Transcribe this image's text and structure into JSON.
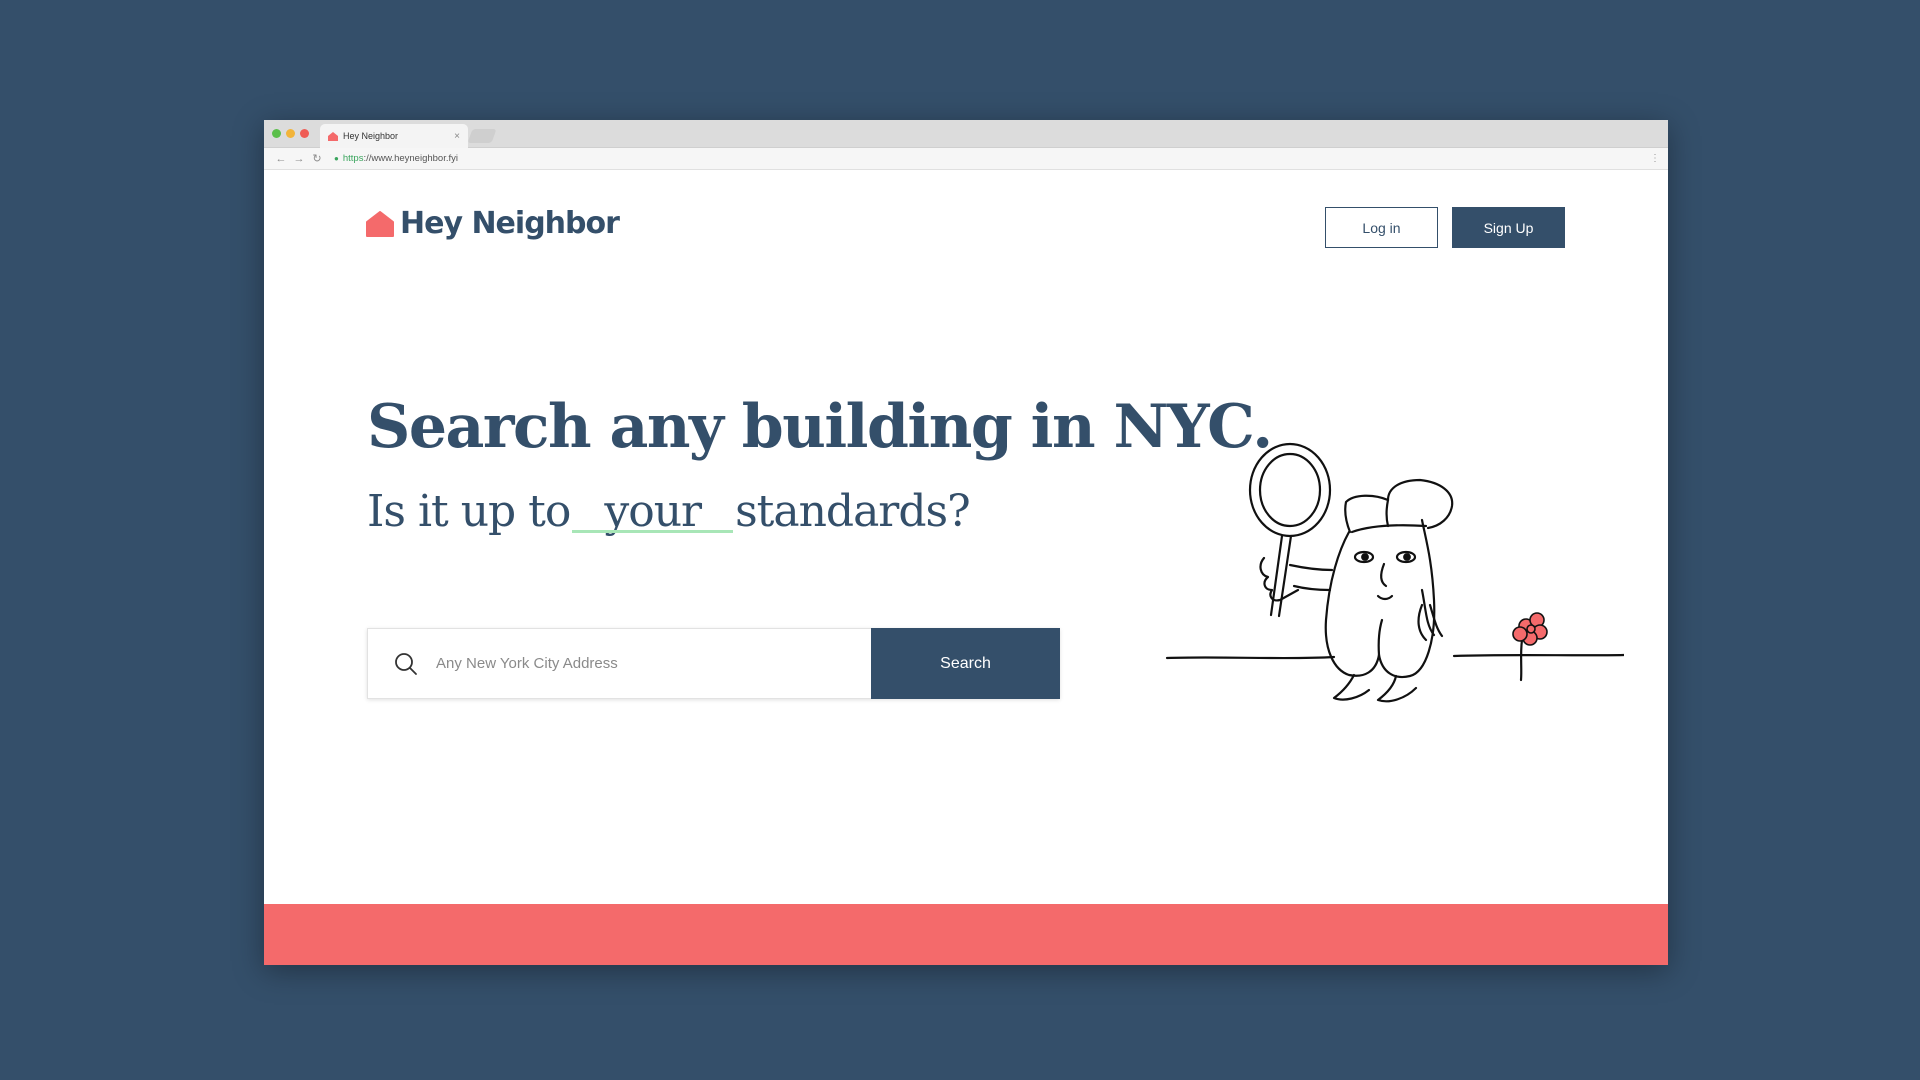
{
  "browser": {
    "tab_title": "Hey Neighbor",
    "tab_close": "×",
    "url_scheme": "https",
    "url_rest": "://www.heyneighbor.fyi",
    "nav_back": "←",
    "nav_forward": "→",
    "nav_reload": "↻",
    "menu": "⋮"
  },
  "header": {
    "logo_text": "Hey Neighbor",
    "login_label": "Log in",
    "signup_label": "Sign Up"
  },
  "hero": {
    "headline": "Search any building in NYC.",
    "sub_before": "Is it up to",
    "sub_emphasis": "your",
    "sub_after": "standards?"
  },
  "search": {
    "placeholder": "Any New York City Address",
    "button_label": "Search"
  },
  "colors": {
    "background": "#344f6a",
    "brand_navy": "#344f6a",
    "brand_coral": "#f46a6b",
    "underline_green": "#a8e6b7"
  },
  "icons": [
    "house-logo-icon",
    "search-icon",
    "back-arrow-icon",
    "forward-arrow-icon",
    "reload-icon",
    "lock-icon",
    "menu-dots-icon"
  ]
}
